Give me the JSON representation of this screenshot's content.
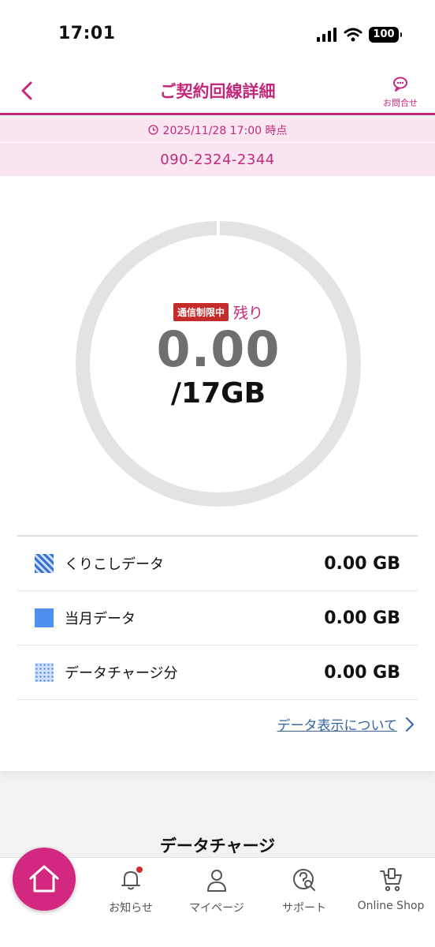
{
  "status_bar": {
    "time": "17:01",
    "battery": "100"
  },
  "header": {
    "title": "ご契約回線詳細",
    "contact_label": "お問合せ"
  },
  "info": {
    "timestamp": "2025/11/28 17:00 時点",
    "phone_number": "090-2324-2344"
  },
  "usage": {
    "badge": "通信制限中",
    "remaining_label": "残り",
    "remaining_value": "0.00",
    "capacity": "/17GB",
    "remaining_fraction": 0,
    "rows": [
      {
        "label": "くりこしデータ",
        "value": "0.00 GB",
        "swatch": "diagonal-stripes"
      },
      {
        "label": "当月データ",
        "value": "0.00 GB",
        "swatch": "solid-blue"
      },
      {
        "label": "データチャージ分",
        "value": "0.00 GB",
        "swatch": "dotted-blue"
      }
    ],
    "info_link": "データ表示について"
  },
  "section": {
    "title": "データチャージ"
  },
  "nav": {
    "home_icon": "home-icon",
    "items": [
      {
        "label": "お知らせ",
        "icon": "bell-icon"
      },
      {
        "label": "マイページ",
        "icon": "person-icon"
      },
      {
        "label": "サポート",
        "icon": "support-search-icon"
      },
      {
        "label": "Online Shop",
        "icon": "cart-icon"
      }
    ]
  },
  "colors": {
    "brand": "#c4287a",
    "home_button": "#d3287f",
    "limit_badge": "#c62b2b",
    "gauge_track": "#e3e3e3",
    "data_blue": "#4d90f0",
    "link": "#3465a4"
  }
}
